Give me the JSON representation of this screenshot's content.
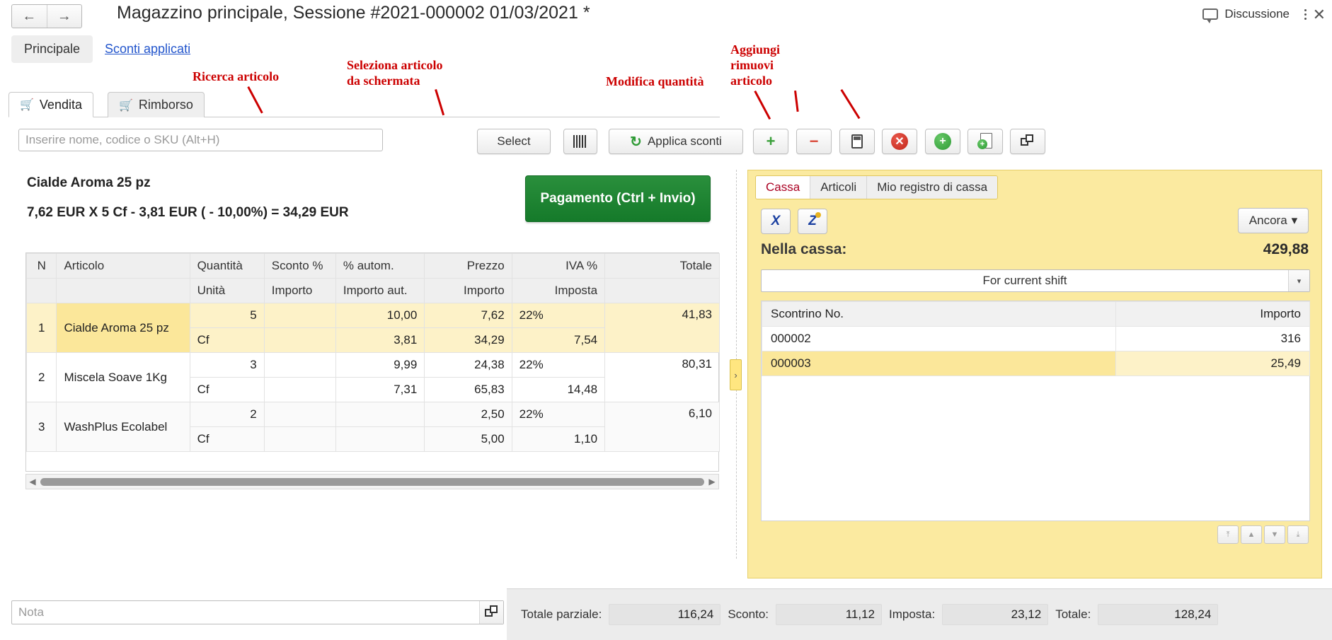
{
  "window": {
    "title": "Magazzino principale, Sessione #2021-000002 01/03/2021 *",
    "back_icon": "arrow-left-icon",
    "forward_icon": "arrow-right-icon",
    "discussion_label": "Discussione",
    "menu_icon": "kebab-menu-icon",
    "close_icon": "close-icon"
  },
  "top_tabs": {
    "principale": "Principale",
    "sconti_applicati": "Sconti applicati"
  },
  "annotations": [
    {
      "text": "Ricerca articolo"
    },
    {
      "text": "Seleziona articolo\nda schermata"
    },
    {
      "text": "Modifica quantità"
    },
    {
      "text": "Aggiungi\nrimuovi\narticolo"
    }
  ],
  "anno_text": {
    "ricerca": "Ricerca articolo",
    "seleziona1": "Seleziona articolo",
    "seleziona2": "da schermata",
    "modifica": "Modifica quantità",
    "aggiungi1": "Aggiungi",
    "aggiungi2": "rimuovi",
    "aggiungi3": "articolo"
  },
  "work_tabs": [
    {
      "label": "Vendita",
      "icon": "shopping-cart-icon",
      "active": true
    },
    {
      "label": "Rimborso",
      "icon": "refund-cart-icon",
      "active": false
    }
  ],
  "toolbar": {
    "search_placeholder": "Inserire nome, codice o SKU (Alt+H)",
    "search_value": "",
    "select_label": "Select",
    "barcode_icon": "barcode-scan-icon",
    "apply_discounts_label": "Applica sconti",
    "apply_discounts_icon": "refresh-icon",
    "plus_label": "+",
    "minus_label": "−",
    "calculator_icon": "calculator-icon",
    "remove_icon": "remove-circle-icon",
    "add_icon": "add-circle-icon",
    "new_doc_icon": "new-document-icon",
    "copy_icon": "copy-icon"
  },
  "item_summary": {
    "name": "Cialde Aroma 25 pz",
    "calculation": "7,62 EUR X 5 Cf - 3,81 EUR ( - 10,00%) = 34,29 EUR"
  },
  "payment": {
    "label": "Pagamento (Ctrl + Invio)",
    "color": "#1a7a2e"
  },
  "grid": {
    "headers_row1": [
      "N",
      "Articolo",
      "Quantità",
      "Sconto %",
      "% autom.",
      "Prezzo",
      "IVA %",
      "Totale"
    ],
    "headers_row2": [
      "",
      "",
      "Unità",
      "Importo",
      "Importo aut.",
      "Importo",
      "Imposta",
      ""
    ],
    "rows": [
      {
        "n": "1",
        "articolo": "Cialde Aroma 25 pz",
        "quantita": "5",
        "sconto": "",
        "autom": "10,00",
        "prezzo": "7,62",
        "iva": "22%",
        "totale": "41,83",
        "unita": "Cf",
        "importo_sconto": "",
        "importo_aut": "3,81",
        "importo": "34,29",
        "imposta": "7,54",
        "selected": true
      },
      {
        "n": "2",
        "articolo": "Miscela Soave 1Kg",
        "quantita": "3",
        "sconto": "",
        "autom": "9,99",
        "prezzo": "24,38",
        "iva": "22%",
        "totale": "80,31",
        "unita": "Cf",
        "importo_sconto": "",
        "importo_aut": "7,31",
        "importo": "65,83",
        "imposta": "14,48",
        "selected": false
      },
      {
        "n": "3",
        "articolo": "WashPlus Ecolabel",
        "quantita": "2",
        "sconto": "",
        "autom": "",
        "prezzo": "2,50",
        "iva": "22%",
        "totale": "6,10",
        "unita": "Cf",
        "importo_sconto": "",
        "importo_aut": "",
        "importo": "5,00",
        "imposta": "1,10",
        "selected": false
      }
    ]
  },
  "splitter": {
    "icon": "chevron-right-icon",
    "label": "›"
  },
  "cash_panel": {
    "tabs": [
      {
        "label": "Cassa",
        "active": true
      },
      {
        "label": "Articoli",
        "active": false
      },
      {
        "label": "Mio registro di cassa",
        "active": false
      }
    ],
    "excel_icon": "excel-export-icon",
    "zreport_icon": "z-report-icon",
    "more_label": "Ancora",
    "more_caret": "▾",
    "in_cash_label": "Nella cassa:",
    "in_cash_value": "429,88",
    "shift_selector": "For current shift",
    "shift_caret": "▾",
    "receipts_headers": [
      "Scontrino No.",
      "Importo"
    ],
    "receipts": [
      {
        "no": "000002",
        "importo": "316",
        "selected": false
      },
      {
        "no": "000003",
        "importo": "25,49",
        "selected": true
      }
    ],
    "nav_icons": [
      "first-page-icon",
      "previous-page-icon",
      "next-page-icon",
      "last-page-icon"
    ],
    "nav_glyphs": [
      "⤒",
      "▲",
      "▼",
      "⤓"
    ]
  },
  "bottom": {
    "note_placeholder": "Nota",
    "note_value": "",
    "note_expand_icon": "expand-icon",
    "totale_parziale_label": "Totale parziale:",
    "totale_parziale_value": "116,24",
    "sconto_label": "Sconto:",
    "sconto_value": "11,12",
    "imposta_label": "Imposta:",
    "imposta_value": "23,12",
    "totale_label": "Totale:",
    "totale_value": "128,24"
  }
}
